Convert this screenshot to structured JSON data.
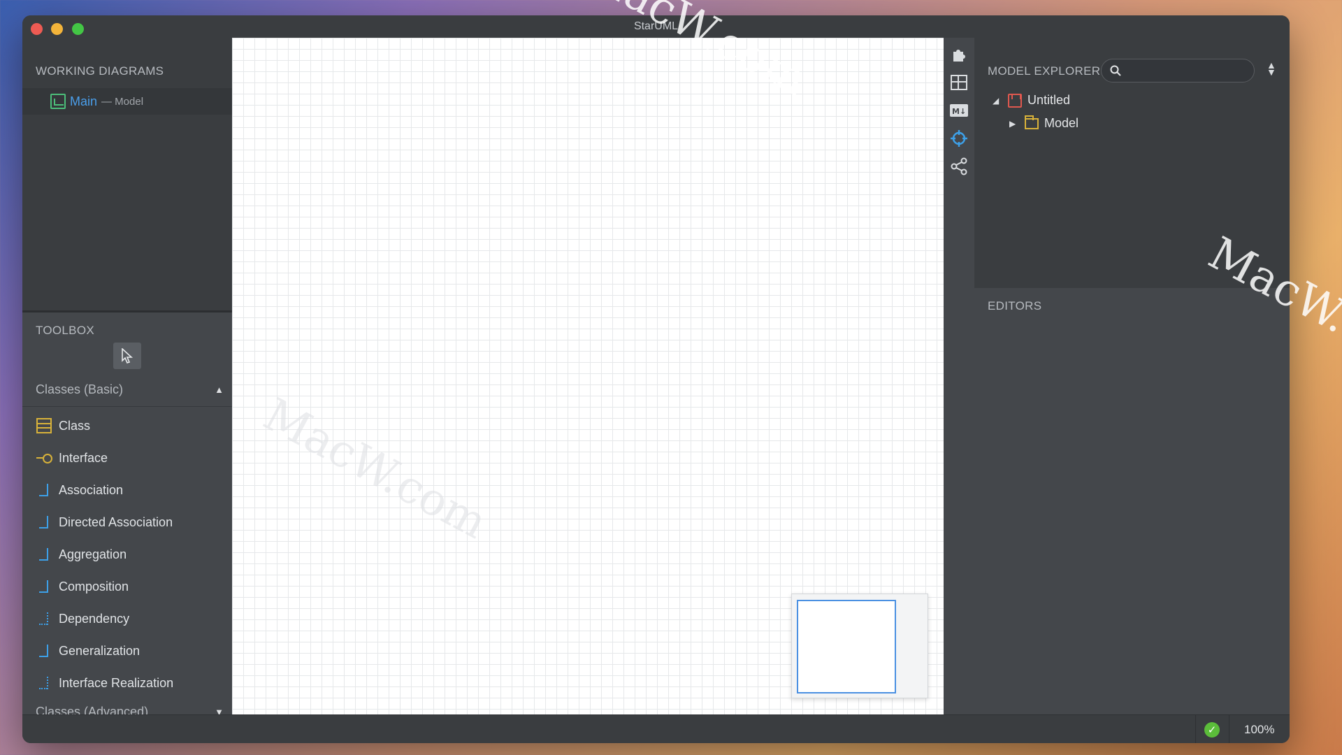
{
  "window": {
    "title": "StarUML"
  },
  "working_diagrams": {
    "header": "WORKING DIAGRAMS",
    "items": [
      {
        "name": "Main",
        "context": "— Model"
      }
    ]
  },
  "toolbox": {
    "header": "TOOLBOX",
    "groups": [
      {
        "label": "Classes (Basic)",
        "expanded": true,
        "items": [
          {
            "label": "Class",
            "icon": "class-icon"
          },
          {
            "label": "Interface",
            "icon": "interface-icon"
          },
          {
            "label": "Association",
            "icon": "association-icon"
          },
          {
            "label": "Directed Association",
            "icon": "directed-association-icon"
          },
          {
            "label": "Aggregation",
            "icon": "aggregation-icon"
          },
          {
            "label": "Composition",
            "icon": "composition-icon"
          },
          {
            "label": "Dependency",
            "icon": "dependency-icon"
          },
          {
            "label": "Generalization",
            "icon": "generalization-icon"
          },
          {
            "label": "Interface Realization",
            "icon": "interface-realization-icon"
          }
        ]
      },
      {
        "label": "Classes (Advanced)",
        "expanded": false
      }
    ]
  },
  "icon_bar": [
    "extensions-icon",
    "layout-icon",
    "markdown-icon",
    "crosshair-icon",
    "share-icon"
  ],
  "model_explorer": {
    "header": "MODEL EXPLORER",
    "search_placeholder": "",
    "tree": [
      {
        "label": "Untitled",
        "icon": "project-cube-icon",
        "expanded": true
      },
      {
        "label": "Model",
        "icon": "model-folder-icon",
        "expanded": false
      }
    ]
  },
  "editors": {
    "header": "EDITORS"
  },
  "status": {
    "zoom": "100%",
    "validation": "ok"
  },
  "watermarks": [
    "MacW.com",
    "MacW.com",
    "MacW.c"
  ],
  "colors": {
    "accent": "#4a9eea",
    "class_icon": "#d8b23a",
    "relation_icon": "#3da0e8",
    "project_icon": "#e0584f",
    "status_ok": "#5bbd3a"
  }
}
